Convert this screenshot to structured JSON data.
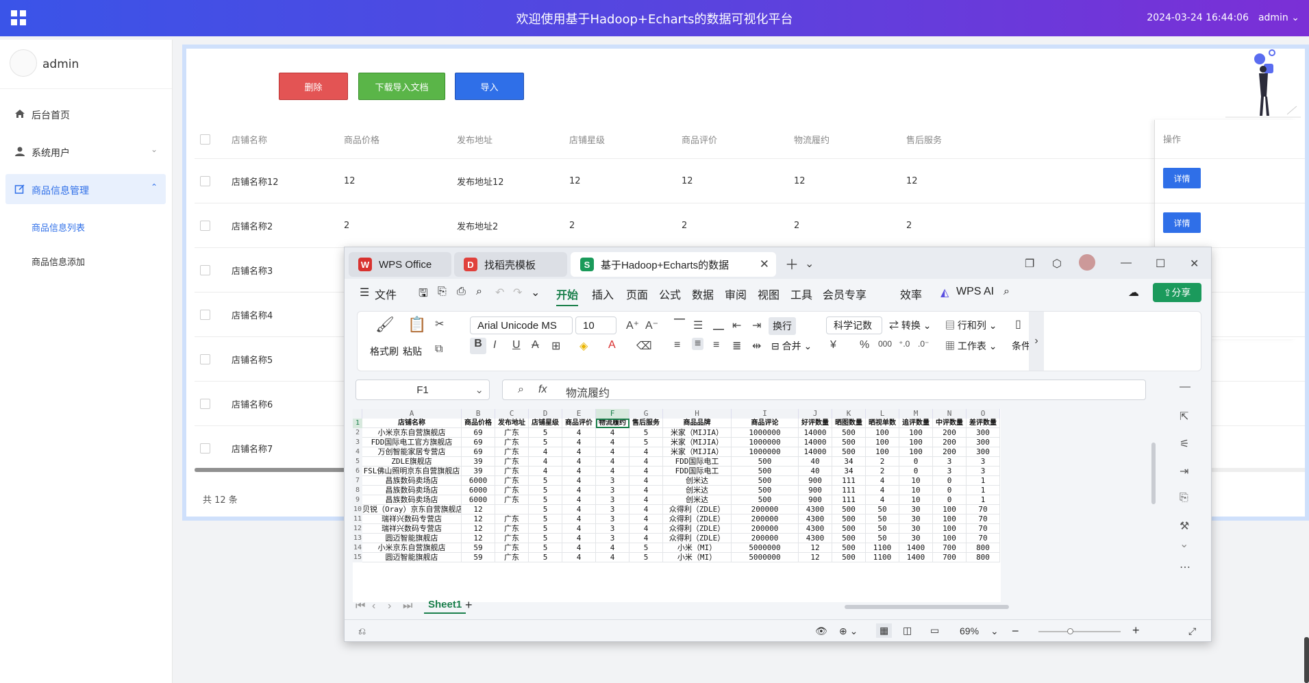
{
  "header": {
    "title": "欢迎使用基于Hadoop+Echarts的数据可视化平台",
    "datetime": "2024-03-24 16:44:06",
    "user": "admin"
  },
  "sidebar": {
    "username": "admin",
    "items": [
      {
        "label": "后台首页"
      },
      {
        "label": "系统用户"
      },
      {
        "label": "商品信息管理"
      }
    ],
    "subitems": [
      {
        "label": "商品信息列表"
      },
      {
        "label": "商品信息添加"
      }
    ]
  },
  "toolbar": {
    "delete_label": "删除",
    "download_label": "下载导入文档",
    "import_label": "导入"
  },
  "table": {
    "headers": [
      "店铺名称",
      "商品价格",
      "发布地址",
      "店铺星级",
      "商品评价",
      "物流履约",
      "售后服务",
      "操作"
    ],
    "rows": [
      [
        "店铺名称12",
        "12",
        "发布地址12",
        "12",
        "12",
        "12",
        "12"
      ],
      [
        "店铺名称2",
        "2",
        "发布地址2",
        "2",
        "2",
        "2",
        "2"
      ],
      [
        "店铺名称3"
      ],
      [
        "店铺名称4"
      ],
      [
        "店铺名称5"
      ],
      [
        "店铺名称6"
      ],
      [
        "店铺名称7"
      ]
    ],
    "detail_label": "详情",
    "total": "共 12 条"
  },
  "wps": {
    "tabs": [
      "WPS Office",
      "找稻壳模板",
      "基于Hadoop+Echarts的数据"
    ],
    "menu": [
      "文件",
      "开始",
      "插入",
      "页面",
      "公式",
      "数据",
      "审阅",
      "视图",
      "工具",
      "会员专享",
      "效率",
      "WPS AI"
    ],
    "share": "分享",
    "ribbon": {
      "format_painter": "格式刷",
      "paste": "粘贴",
      "font": "Arial Unicode MS",
      "size": "10",
      "wrap": "换行",
      "merge": "合并",
      "numfmt": "科学记数",
      "convert": "转换",
      "rowcol": "行和列",
      "worksheet": "工作表",
      "cond": "条件"
    },
    "namebox": "F1",
    "formula": "物流履约",
    "columns": [
      "A",
      "B",
      "C",
      "D",
      "E",
      "F",
      "G",
      "H",
      "I",
      "J",
      "K",
      "L",
      "M",
      "N",
      "O"
    ],
    "sheet_rows": [
      [
        "店铺名称",
        "商品价格",
        "发布地址",
        "店铺星级",
        "商品评价",
        "物流履约",
        "售后服务",
        "商品品牌",
        "商品评论",
        "好评数量",
        "晒图数量",
        "晒视单数",
        "追评数量",
        "中评数量",
        "差评数量"
      ],
      [
        "小米京东自营旗舰店",
        "69",
        "广东",
        "5",
        "4",
        "4",
        "5",
        "米家（MIJIA）",
        "1000000",
        "14000",
        "500",
        "100",
        "100",
        "200",
        "300"
      ],
      [
        "FDD国际电工官方旗舰店",
        "69",
        "广东",
        "5",
        "4",
        "4",
        "5",
        "米家（MIJIA）",
        "1000000",
        "14000",
        "500",
        "100",
        "100",
        "200",
        "300"
      ],
      [
        "万创智能家居专营店",
        "69",
        "广东",
        "4",
        "4",
        "4",
        "4",
        "米家（MIJIA）",
        "1000000",
        "14000",
        "500",
        "100",
        "100",
        "200",
        "300"
      ],
      [
        "ZDLE旗舰店",
        "39",
        "广东",
        "4",
        "4",
        "4",
        "4",
        "FDD国际电工",
        "500",
        "40",
        "34",
        "2",
        "0",
        "3",
        "3"
      ],
      [
        "FSL佛山照明京东自营旗舰店",
        "39",
        "广东",
        "4",
        "4",
        "4",
        "4",
        "FDD国际电工",
        "500",
        "40",
        "34",
        "2",
        "0",
        "3",
        "3"
      ],
      [
        "昌族数码卖场店",
        "6000",
        "广东",
        "5",
        "4",
        "3",
        "4",
        "创米达",
        "500",
        "900",
        "111",
        "4",
        "10",
        "0",
        "1"
      ],
      [
        "昌族数码卖场店",
        "6000",
        "广东",
        "5",
        "4",
        "3",
        "4",
        "创米达",
        "500",
        "900",
        "111",
        "4",
        "10",
        "0",
        "1"
      ],
      [
        "昌族数码卖场店",
        "6000",
        "广东",
        "5",
        "4",
        "3",
        "4",
        "创米达",
        "500",
        "900",
        "111",
        "4",
        "10",
        "0",
        "1"
      ],
      [
        "贝锐（Oray）京东自营旗舰店",
        "12",
        "",
        "5",
        "4",
        "3",
        "4",
        "众得利（ZDLE）",
        "200000",
        "4300",
        "500",
        "50",
        "30",
        "100",
        "70"
      ],
      [
        "瑞祥兴数码专营店",
        "12",
        "广东",
        "5",
        "4",
        "3",
        "4",
        "众得利（ZDLE）",
        "200000",
        "4300",
        "500",
        "50",
        "30",
        "100",
        "70"
      ],
      [
        "瑞祥兴数码专营店",
        "12",
        "广东",
        "5",
        "4",
        "3",
        "4",
        "众得利（ZDLE）",
        "200000",
        "4300",
        "500",
        "50",
        "30",
        "100",
        "70"
      ],
      [
        "圆迈智能旗舰店",
        "12",
        "广东",
        "5",
        "4",
        "3",
        "4",
        "众得利（ZDLE）",
        "200000",
        "4300",
        "500",
        "50",
        "30",
        "100",
        "70"
      ],
      [
        "小米京东自营旗舰店",
        "59",
        "广东",
        "5",
        "4",
        "4",
        "5",
        "小米（MI）",
        "5000000",
        "12",
        "500",
        "1100",
        "1400",
        "700",
        "800"
      ],
      [
        "圆迈智能旗舰店",
        "59",
        "广东",
        "5",
        "4",
        "4",
        "5",
        "小米（MI）",
        "5000000",
        "12",
        "500",
        "1100",
        "1400",
        "700",
        "800"
      ]
    ],
    "sheet_tab": "Sheet1",
    "zoom": "69%"
  }
}
